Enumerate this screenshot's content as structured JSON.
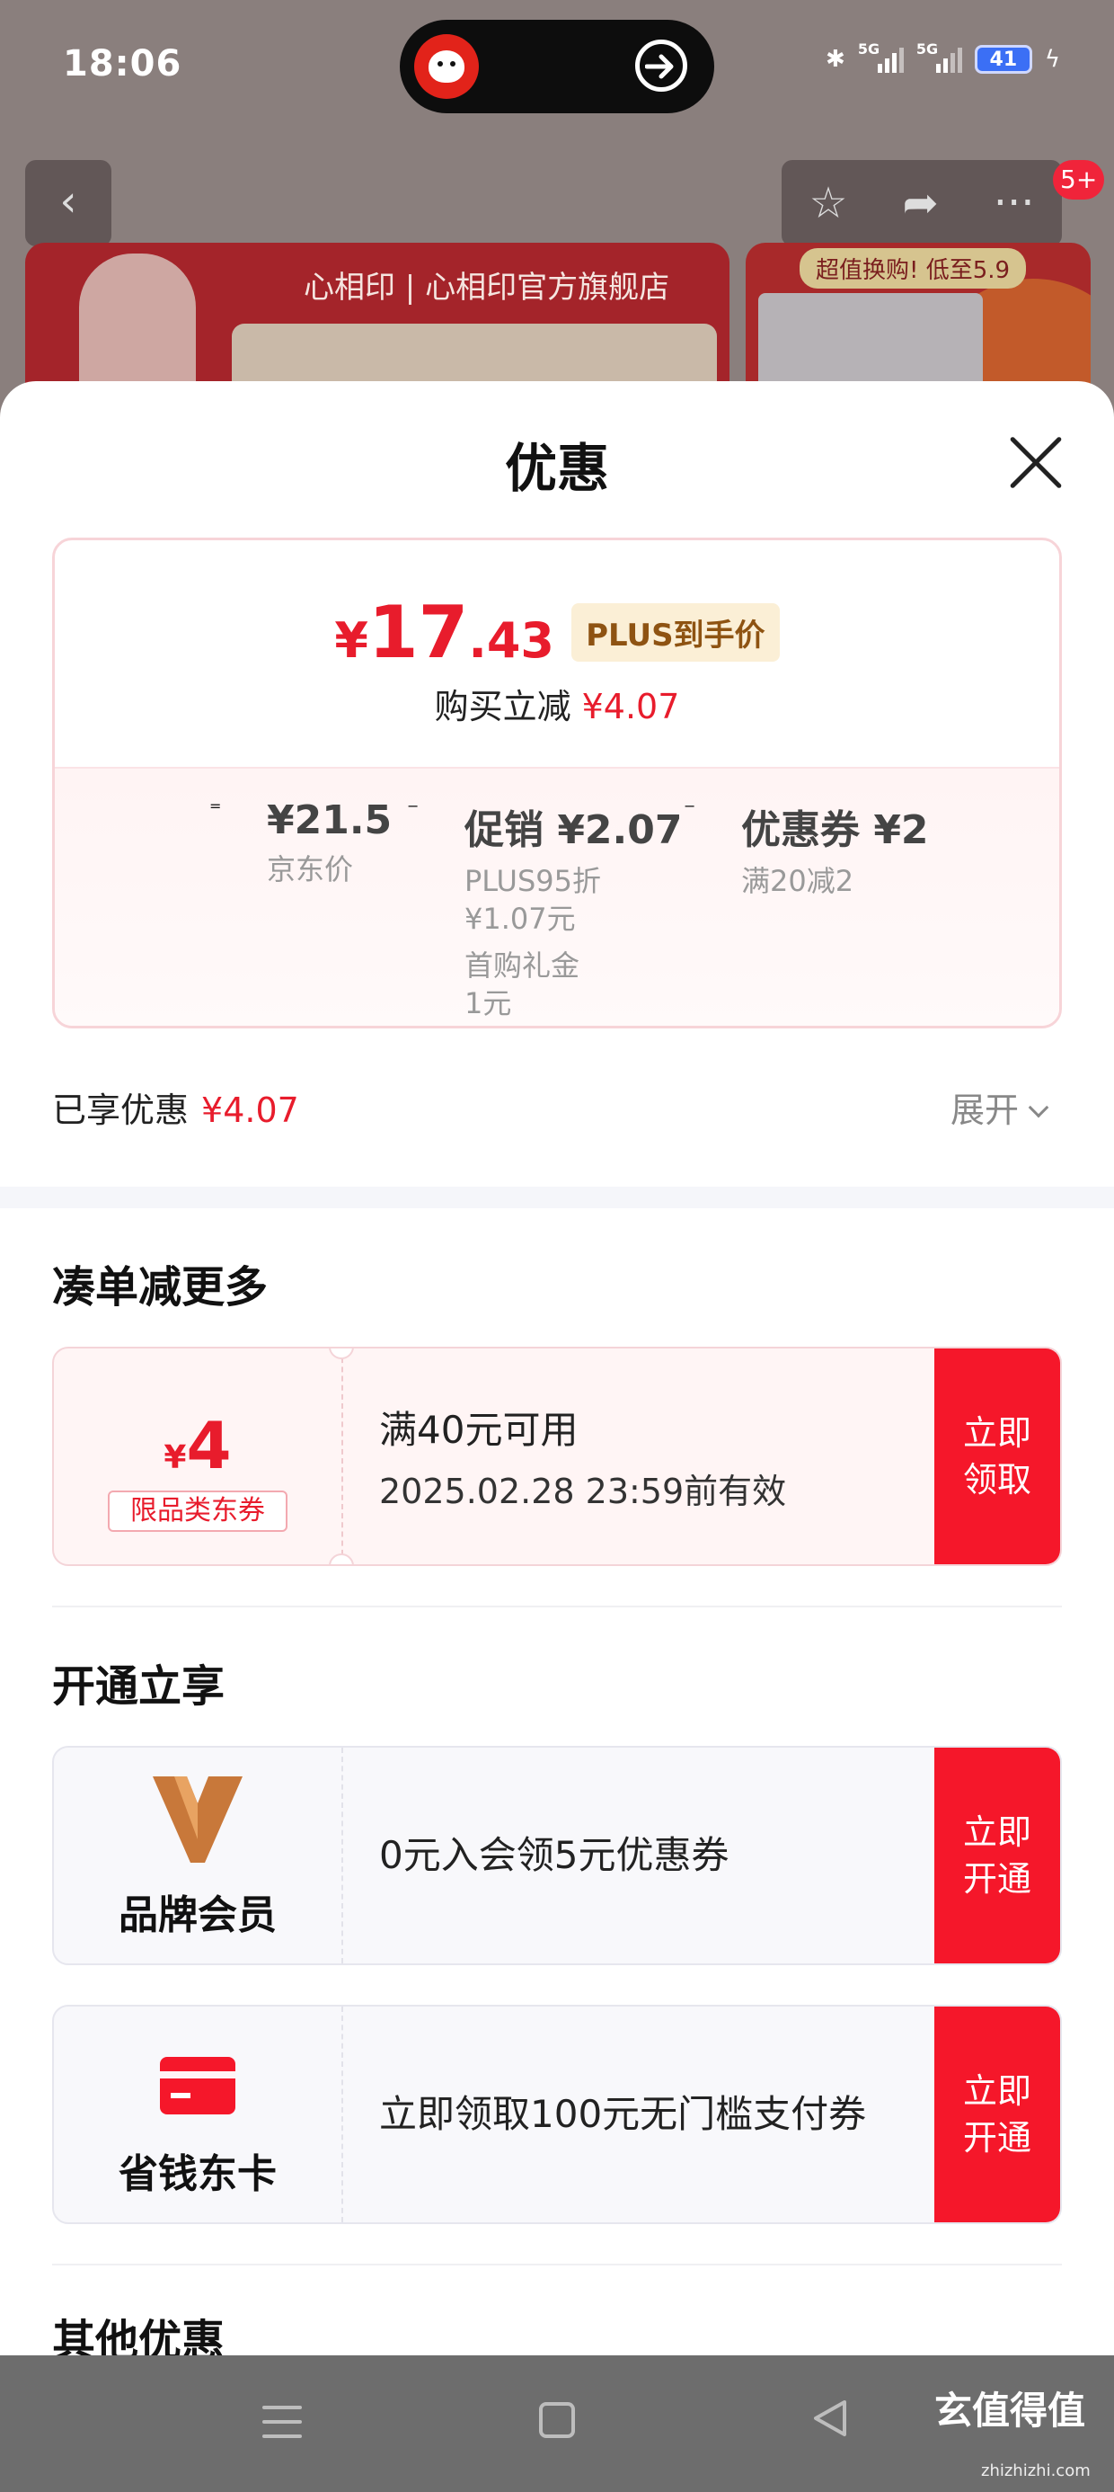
{
  "status_bar": {
    "time": "18:06",
    "network_1": "5G",
    "network_2": "5G",
    "battery": "41"
  },
  "background_page": {
    "notification_badge": "5+",
    "banner_brand": "心相印 | 心相印官方旗舰店",
    "banner_promo": "超值换购! 低至5.9"
  },
  "sheet": {
    "title": "优惠",
    "price_card": {
      "final_price_symbol": "¥",
      "final_price_int": "17",
      "final_price_dec": ".43",
      "plus_tag": "PLUS到手价",
      "instant_label": "购买立减",
      "instant_value": "¥4.07",
      "equals": "=",
      "minus": "−",
      "jd_price": "¥21.5",
      "jd_price_label": "京东价",
      "promo_main": "促销 ¥2.07",
      "promo_sub_1": "PLUS95折",
      "promo_sub_2": "¥1.07元",
      "promo_sub_3": "首购礼金",
      "promo_sub_4": "1元",
      "coupon_main": "优惠券 ¥2",
      "coupon_sub": "满20减2"
    },
    "enjoyed_label": "已享优惠",
    "enjoyed_value": "¥4.07",
    "expand_label": "展开",
    "section_more": "凑单减更多",
    "coupon_1": {
      "symbol": "¥",
      "amount": "4",
      "tag": "限品类东券",
      "condition": "满40元可用",
      "validity": "2025.02.28 23:59前有效",
      "action": "立即领取"
    },
    "section_open": "开通立享",
    "member_1": {
      "label": "品牌会员",
      "text": "0元入会领5元优惠券",
      "action": "立即开通"
    },
    "member_2": {
      "label": "省钱东卡",
      "text": "立即领取100元无门槛支付券",
      "action": "立即开通"
    },
    "section_other": "其他优惠"
  },
  "watermark": {
    "text": "玄值得值",
    "sub": "zhizhizhi.com"
  },
  "colors": {
    "accent_red": "#e81c2c",
    "action_red": "#f5172a",
    "plus_gold": "#8e5312"
  }
}
